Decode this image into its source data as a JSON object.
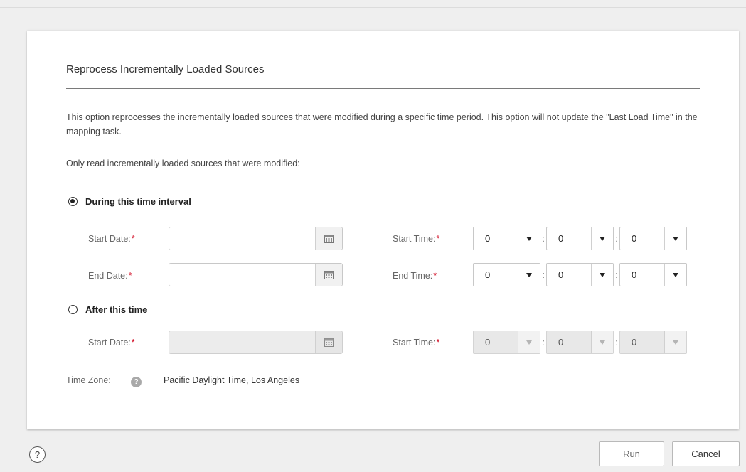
{
  "dialog": {
    "title": "Reprocess Incrementally Loaded Sources",
    "description": "This option reprocesses the incrementally loaded sources that were modified during a specific time period. This option will not update the \"Last Load Time\" in the mapping task.",
    "instruction": "Only read incrementally loaded sources that were modified:"
  },
  "interval_option": {
    "label": "During this time interval",
    "selected": true,
    "start_date_label": "Start Date:",
    "start_date_value": "",
    "end_date_label": "End Date:",
    "end_date_value": "",
    "start_time_label": "Start Time:",
    "start_time": {
      "hour": "0",
      "minute": "0",
      "second": "0"
    },
    "end_time_label": "End Time:",
    "end_time": {
      "hour": "0",
      "minute": "0",
      "second": "0"
    }
  },
  "after_option": {
    "label": "After this time",
    "selected": false,
    "start_date_label": "Start Date:",
    "start_date_value": "",
    "start_time_label": "Start Time:",
    "start_time": {
      "hour": "0",
      "minute": "0",
      "second": "0"
    }
  },
  "required_marker": "*",
  "time_separator": ":",
  "time_zone": {
    "label": "Time Zone:",
    "help_glyph": "?",
    "value": "Pacific Daylight Time, Los Angeles"
  },
  "footer": {
    "help_glyph": "?",
    "run_label": "Run",
    "cancel_label": "Cancel"
  },
  "icons": {
    "calendar": "calendar-icon",
    "dropdown": "caret-down-icon",
    "help": "help-icon"
  },
  "colors": {
    "required": "#d0021b",
    "panel_background": "#ffffff",
    "page_background": "#efefef",
    "disabled_field": "#ececec"
  }
}
